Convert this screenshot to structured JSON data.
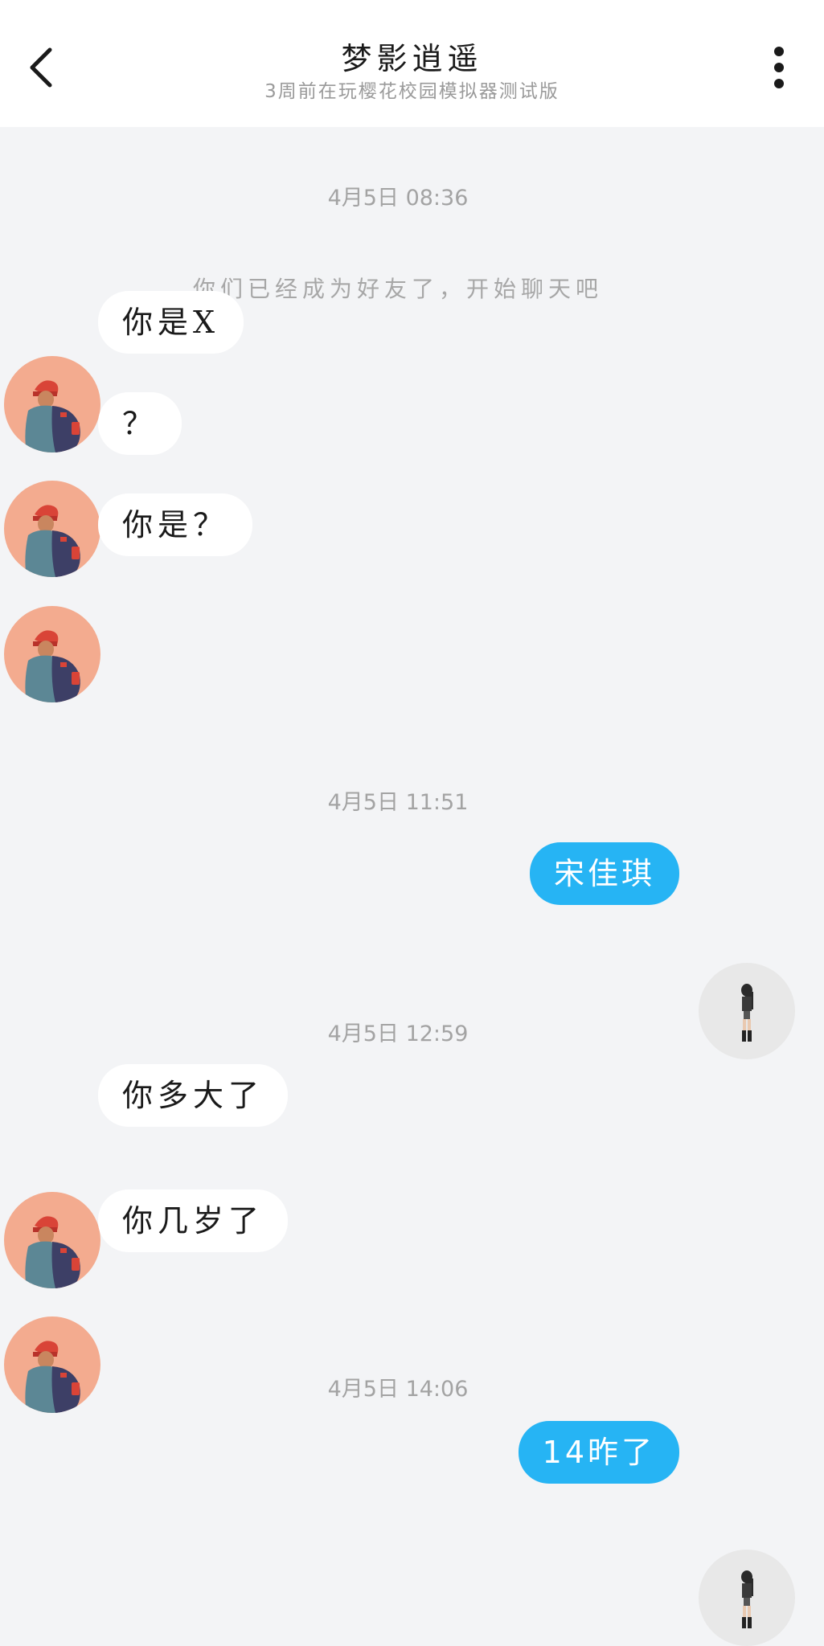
{
  "header": {
    "title": "梦影逍遥",
    "subtitle": "3周前在玩樱花校园模拟器测试版",
    "back_icon": "chevron-left-icon",
    "more_icon": "more-vertical-icon"
  },
  "chat": {
    "timestamps": [
      "4月5日 08:36",
      "4月5日 11:51",
      "4月5日 12:59",
      "4月5日 14:06"
    ],
    "system_notice": "你们已经成为好友了，开始聊天吧",
    "messages": [
      {
        "side": "in",
        "text": "你是X"
      },
      {
        "side": "in",
        "text": "？"
      },
      {
        "side": "in",
        "text": "你是？"
      },
      {
        "side": "out",
        "text": "宋佳琪"
      },
      {
        "side": "in",
        "text": "你多大了"
      },
      {
        "side": "in",
        "text": "你几岁了"
      },
      {
        "side": "out",
        "text": "14昨了"
      }
    ]
  },
  "colors": {
    "outgoing_bubble": "#26b4f4",
    "incoming_bubble": "#ffffff",
    "background": "#f3f4f6",
    "peer_avatar_bg": "#f3ab8f",
    "self_avatar_bg": "#e8e8e8"
  }
}
